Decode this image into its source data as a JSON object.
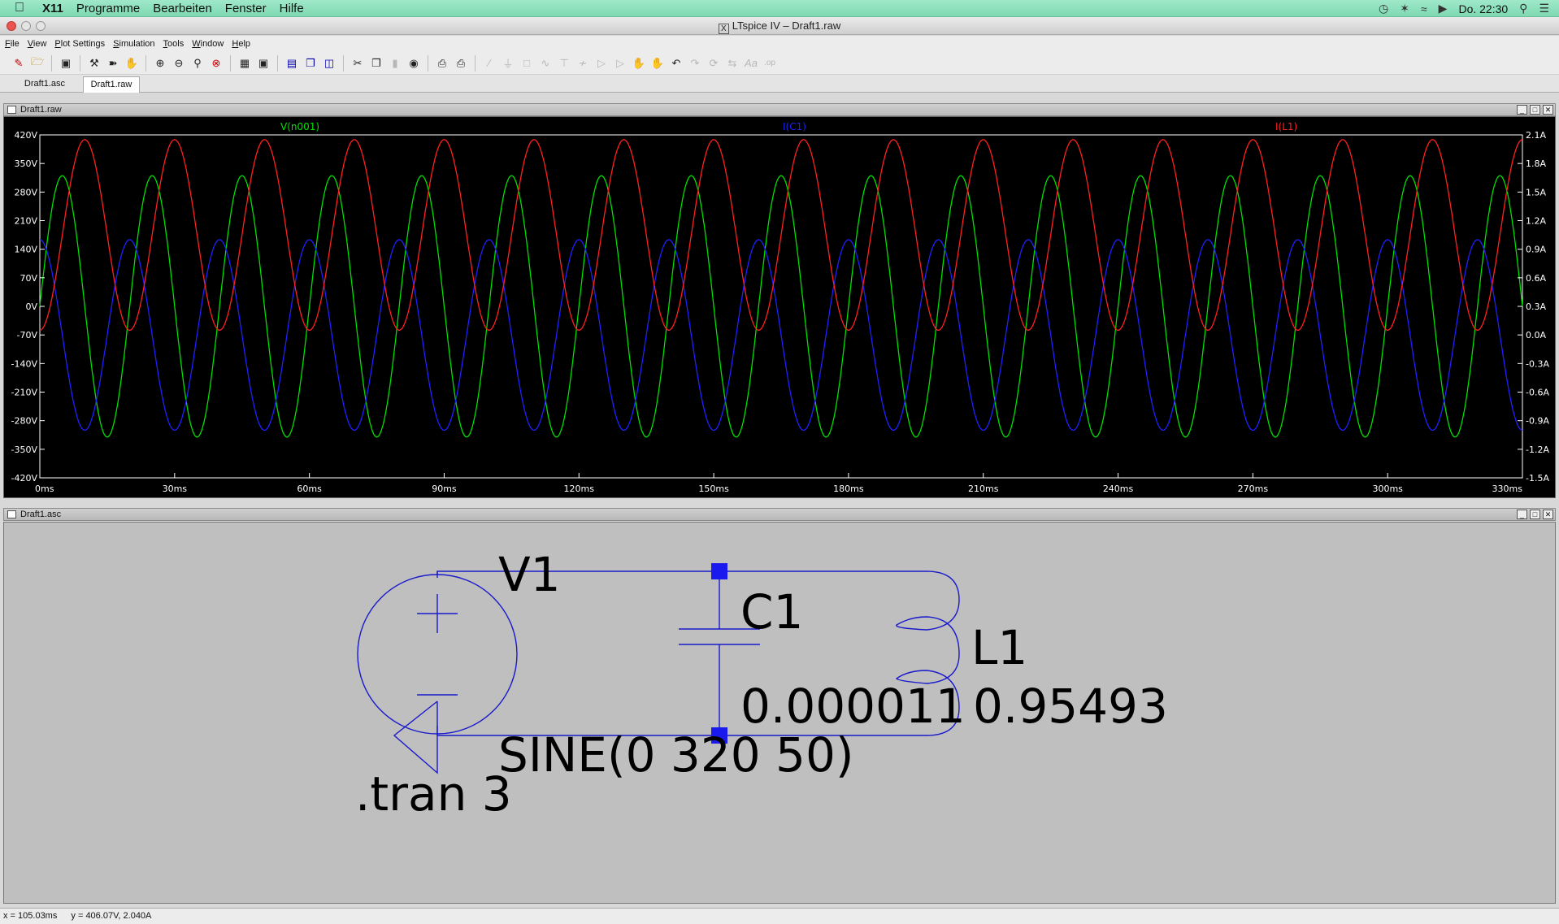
{
  "menubar": {
    "app": "X11",
    "items": [
      "Programme",
      "Bearbeiten",
      "Fenster",
      "Hilfe"
    ],
    "clock": "Do. 22:30"
  },
  "window": {
    "title": "LTspice IV – Draft1.raw"
  },
  "appmenu": {
    "items": [
      "File",
      "View",
      "Plot Settings",
      "Simulation",
      "Tools",
      "Window",
      "Help"
    ]
  },
  "toolbar": {
    "icons": [
      "new-schematic-icon",
      "open-icon",
      "save-icon",
      "control-panel-icon",
      "run-icon",
      "halt-icon",
      "zoom-in-icon",
      "zoom-out-icon",
      "zoom-area-icon",
      "zoom-cancel-icon",
      "autorange-icon",
      "pick-trace-icon",
      "tile-horizontal-icon",
      "cascade-icon",
      "tile-vertical-icon",
      "cut-icon",
      "copy-icon",
      "paste-icon",
      "find-icon",
      "print-setup-icon",
      "print-icon",
      "wire-icon",
      "ground-icon",
      "label-icon",
      "resistor-icon",
      "capacitor-icon",
      "inductor-icon",
      "diode-icon",
      "component-icon",
      "move-icon",
      "drag-icon",
      "undo-icon",
      "redo-icon",
      "rotate-icon",
      "mirror-icon",
      "text-icon",
      "spice-directive-icon"
    ]
  },
  "tabs": [
    {
      "label": "Draft1.asc"
    },
    {
      "label": "Draft1.raw"
    }
  ],
  "plot_window": {
    "title": "Draft1.raw"
  },
  "schematic_window": {
    "title": "Draft1.asc"
  },
  "chart_data": {
    "type": "line",
    "title": "",
    "x_unit": "ms",
    "xlim": [
      0,
      330
    ],
    "x_ticks": [
      "0ms",
      "30ms",
      "60ms",
      "90ms",
      "120ms",
      "150ms",
      "180ms",
      "210ms",
      "240ms",
      "270ms",
      "300ms",
      "330ms"
    ],
    "y_left": {
      "lim": [
        -420,
        420
      ],
      "ticks": [
        "420V",
        "350V",
        "280V",
        "210V",
        "140V",
        "70V",
        "0V",
        "-70V",
        "-140V",
        "-210V",
        "-280V",
        "-350V",
        "-420V"
      ]
    },
    "y_right": {
      "lim": [
        -1.5,
        2.1
      ],
      "ticks": [
        "2.1A",
        "1.8A",
        "1.5A",
        "1.2A",
        "0.9A",
        "0.6A",
        "0.3A",
        "0.0A",
        "-0.3A",
        "-0.6A",
        "-0.9A",
        "-1.2A",
        "-1.5A"
      ]
    },
    "grid": false,
    "legend": "top",
    "series": [
      {
        "name": "V(n001)",
        "axis": "left",
        "color": "#00e000",
        "frequency_hz": 50,
        "amplitude": 320,
        "offset": 0,
        "phase_deg": 0
      },
      {
        "name": "I(C1)",
        "axis": "right",
        "color": "#2020ff",
        "frequency_hz": 50,
        "amplitude": 1.0,
        "offset": 0,
        "phase_deg": 90
      },
      {
        "name": "I(L1)",
        "axis": "right",
        "color": "#ff2020",
        "frequency_hz": 50,
        "amplitude": 1.0,
        "offset": 1.05,
        "phase_deg": -90
      }
    ]
  },
  "schematic": {
    "v1_name": "V1",
    "v1_value": "SINE(0 320 50)",
    "c1_name": "C1",
    "c1_value": "0.000011",
    "l1_name": "L1",
    "l1_value": "0.95493",
    "directive": ".tran 3"
  },
  "status": {
    "x": "x = 105.03ms",
    "y": "y = 406.07V, 2.040A"
  }
}
